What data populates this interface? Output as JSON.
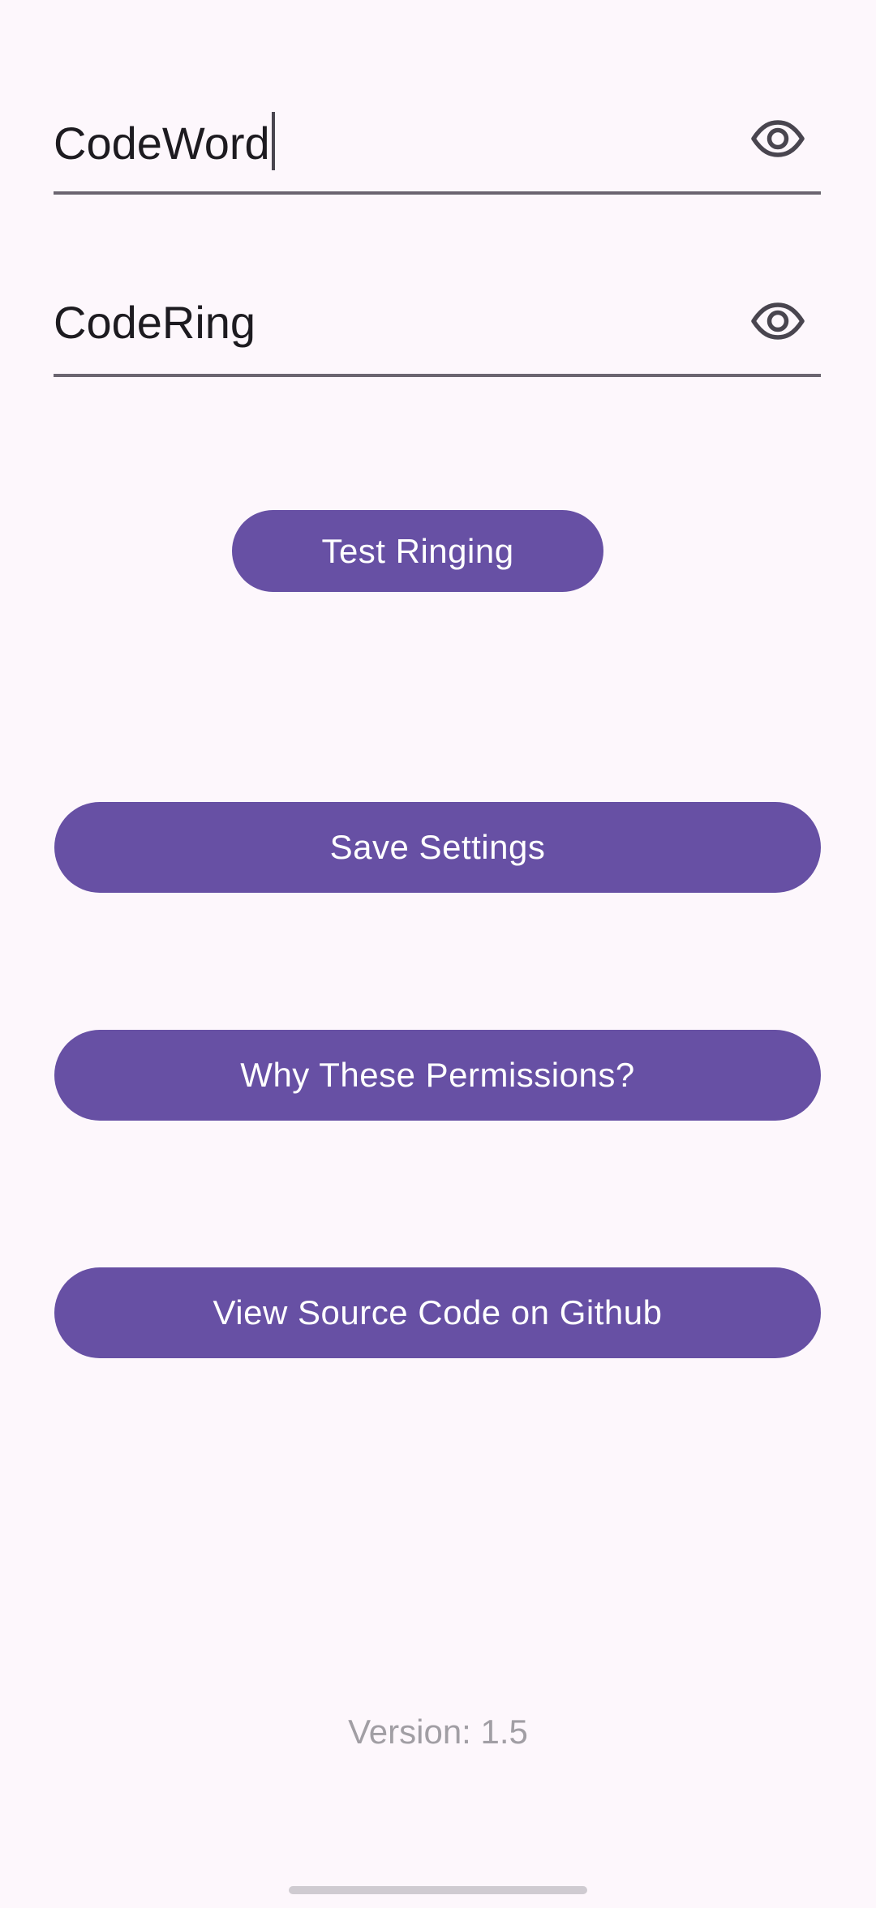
{
  "fields": {
    "codeword": {
      "value": "CodeWord",
      "icon": "eye-icon"
    },
    "codering": {
      "value": "CodeRing",
      "icon": "eye-icon"
    }
  },
  "buttons": {
    "test_ringing": "Test Ringing",
    "save_settings": "Save Settings",
    "why_permissions": "Why These Permissions?",
    "view_source": "View Source Code on Github"
  },
  "footer": {
    "version": "Version: 1.5"
  },
  "colors": {
    "background": "#FDF7FC",
    "primary": "#6750A4",
    "on_primary": "#FFFFFF",
    "text": "#1D1B20",
    "underline": "#6B6570",
    "version_text": "#A19EA4"
  }
}
